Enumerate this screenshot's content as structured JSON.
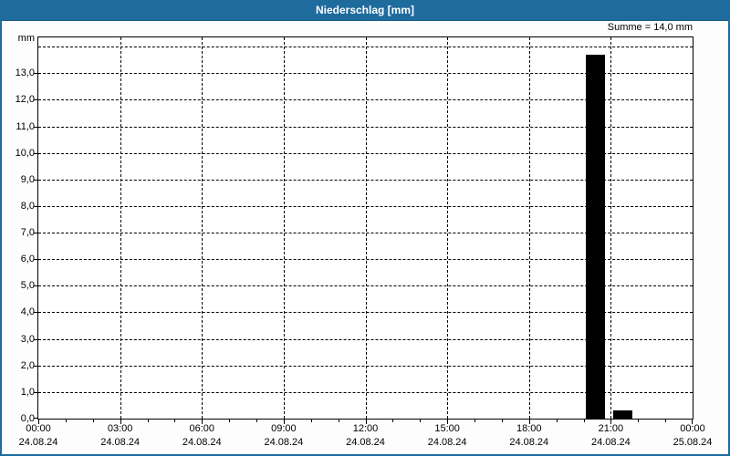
{
  "window": {
    "title": "Niederschlag [mm]"
  },
  "summary": {
    "text": "Summe = 14,0 mm"
  },
  "colors": {
    "titlebar": "#1e6b9e",
    "border": "#1e6b9e",
    "bar": "#000000",
    "grid": "#000000",
    "axis": "#000000",
    "title_text": "#ffffff",
    "plot_background": "#ffffff"
  },
  "chart_data": {
    "type": "bar",
    "title": "Niederschlag [mm]",
    "ylabel": "mm",
    "sum_label": "Summe = 14,0 mm",
    "total_mm": 14.0,
    "grid": "dashed",
    "legend": "none",
    "ylim": [
      0,
      14.35
    ],
    "y_gridline_step": 1.0,
    "y_tick_labels": [
      "0,0",
      "1,0",
      "2,0",
      "3,0",
      "4,0",
      "5,0",
      "6,0",
      "7,0",
      "8,0",
      "9,0",
      "10,0",
      "11,0",
      "12,0",
      "13,0"
    ],
    "x_axis": {
      "hours_span": 24,
      "minor_tick_every_hours": 1,
      "major_tick_every_hours": 3,
      "v_gridline_hours": [
        3,
        6,
        9,
        12,
        15,
        18,
        21
      ],
      "major_ticks": [
        {
          "time": "00:00",
          "date": "24.08.24"
        },
        {
          "time": "03:00",
          "date": "24.08.24"
        },
        {
          "time": "06:00",
          "date": "24.08.24"
        },
        {
          "time": "09:00",
          "date": "24.08.24"
        },
        {
          "time": "12:00",
          "date": "24.08.24"
        },
        {
          "time": "15:00",
          "date": "24.08.24"
        },
        {
          "time": "18:00",
          "date": "24.08.24"
        },
        {
          "time": "21:00",
          "date": "24.08.24"
        },
        {
          "time": "00:00",
          "date": "25.08.24"
        }
      ]
    },
    "bars": [
      {
        "start_hour": 20,
        "end_hour": 21,
        "start_time": "20:00",
        "end_time": "21:00",
        "value_mm": 13.7
      },
      {
        "start_hour": 21,
        "end_hour": 22,
        "start_time": "21:00",
        "end_time": "22:00",
        "value_mm": 0.3
      }
    ]
  }
}
